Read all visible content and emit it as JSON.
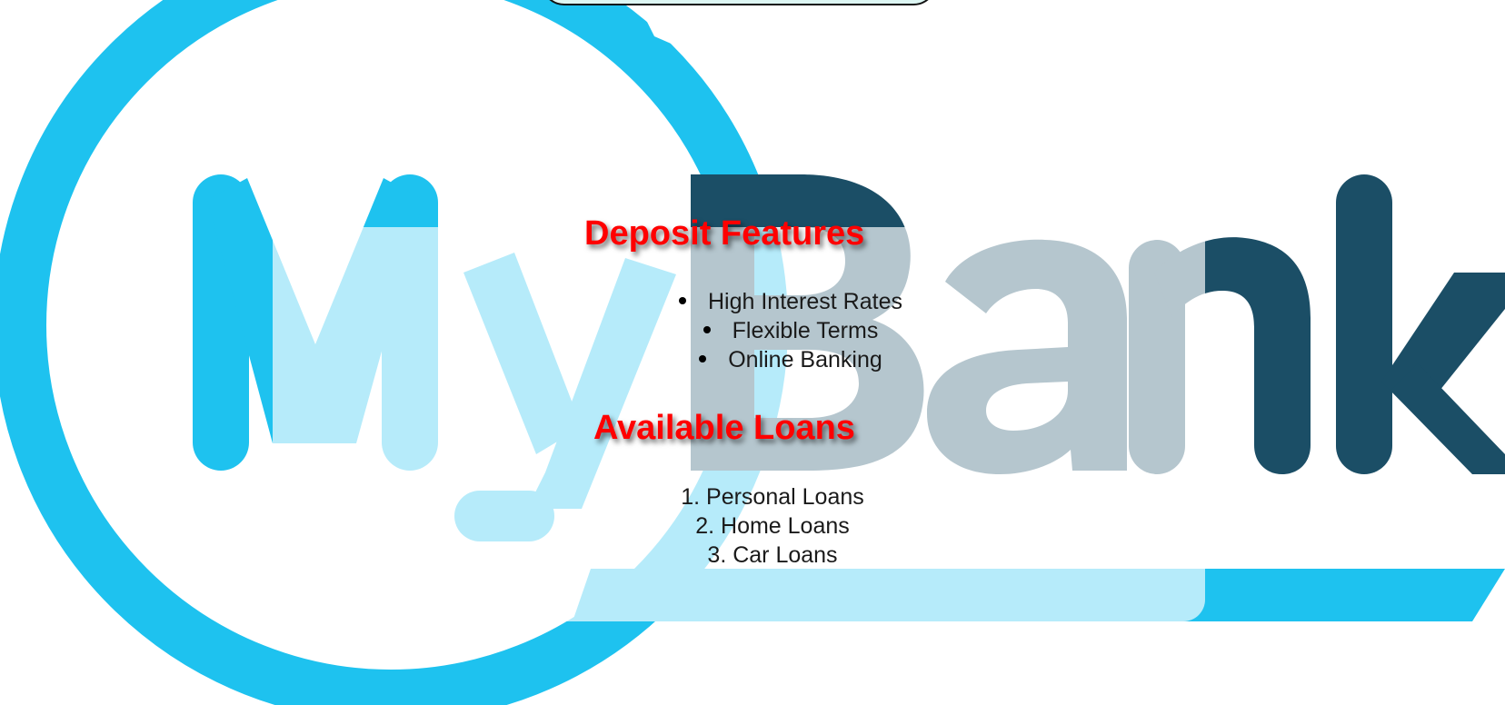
{
  "logo": {
    "word_my": "My",
    "word_bank": "Bank",
    "colors": {
      "light_blue": "#1ec2ef",
      "dark_teal": "#1b4e66",
      "faded_blue": "#bce9f8",
      "faded_gray": "#b7c8d1"
    }
  },
  "sections": {
    "deposit": {
      "title": "Deposit Features",
      "items": [
        "High Interest Rates",
        "Flexible Terms",
        "Online Banking"
      ]
    },
    "loans": {
      "title": "Available Loans",
      "items": [
        "1. Personal Loans",
        "2. Home Loans",
        "3. Car Loans"
      ]
    }
  },
  "colors": {
    "heading": "#ff0000",
    "body_text": "#1a1a1a",
    "top_tab": "#ddf6f3"
  }
}
